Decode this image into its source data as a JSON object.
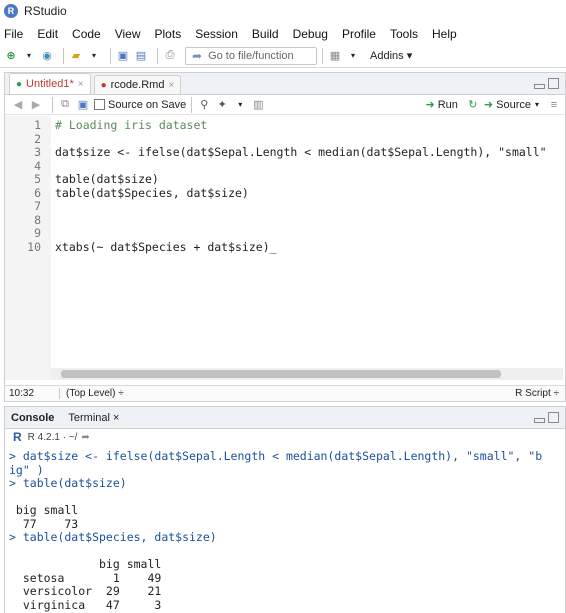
{
  "app": {
    "title": "RStudio",
    "logo": "R"
  },
  "menu": [
    "File",
    "Edit",
    "Code",
    "View",
    "Plots",
    "Session",
    "Build",
    "Debug",
    "Profile",
    "Tools",
    "Help"
  ],
  "toolbar": {
    "goto_placeholder": "Go to file/function",
    "addins_label": "Addins ▾"
  },
  "source_tabs": [
    {
      "name": "Untitled1*",
      "active": true
    },
    {
      "name": "rcode.Rmd",
      "active": false
    }
  ],
  "editor_toolbar": {
    "source_on_save": "Source on Save",
    "run_label": "Run",
    "source_label": "Source"
  },
  "editor_lines": [
    {
      "num": "1",
      "text": "# Loading iris dataset",
      "kind": "comment"
    },
    {
      "num": "2",
      "text": "",
      "kind": "code"
    },
    {
      "num": "3",
      "text": "dat$size <- ifelse(dat$Sepal.Length < median(dat$Sepal.Length), \"small\"",
      "kind": "code"
    },
    {
      "num": "4",
      "text": "",
      "kind": "code"
    },
    {
      "num": "5",
      "text": "table(dat$size)",
      "kind": "code"
    },
    {
      "num": "6",
      "text": "table(dat$Species, dat$size)",
      "kind": "code"
    },
    {
      "num": "7",
      "text": "",
      "kind": "code"
    },
    {
      "num": "8",
      "text": "",
      "kind": "code"
    },
    {
      "num": "9",
      "text": "",
      "kind": "code"
    },
    {
      "num": "10",
      "text": "xtabs(~ dat$Species + dat$size)_",
      "kind": "code"
    }
  ],
  "status": {
    "position": "10:32",
    "scope": "(Top Level) ÷",
    "filetype": "R Script ÷"
  },
  "console_tabs": [
    {
      "name": "Console",
      "active": true
    },
    {
      "name": "Terminal ×",
      "active": false
    }
  ],
  "console_info": "R 4.2.1 · ~/",
  "console_lines": [
    {
      "text": "> dat$size <- ifelse(dat$Sepal.Length < median(dat$Sepal.Length), \"small\", \"b",
      "kind": "cmd"
    },
    {
      "text": "ig\" )",
      "kind": "cmd"
    },
    {
      "text": "> table(dat$size)",
      "kind": "cmd"
    },
    {
      "text": "",
      "kind": "out"
    },
    {
      "text": " big small",
      "kind": "out"
    },
    {
      "text": "  77    73",
      "kind": "out"
    },
    {
      "text": "> table(dat$Species, dat$size)",
      "kind": "cmd"
    },
    {
      "text": "",
      "kind": "out"
    },
    {
      "text": "             big small",
      "kind": "out"
    },
    {
      "text": "  setosa       1    49",
      "kind": "out"
    },
    {
      "text": "  versicolor  29    21",
      "kind": "out"
    },
    {
      "text": "  virginica   47     3",
      "kind": "out"
    }
  ]
}
